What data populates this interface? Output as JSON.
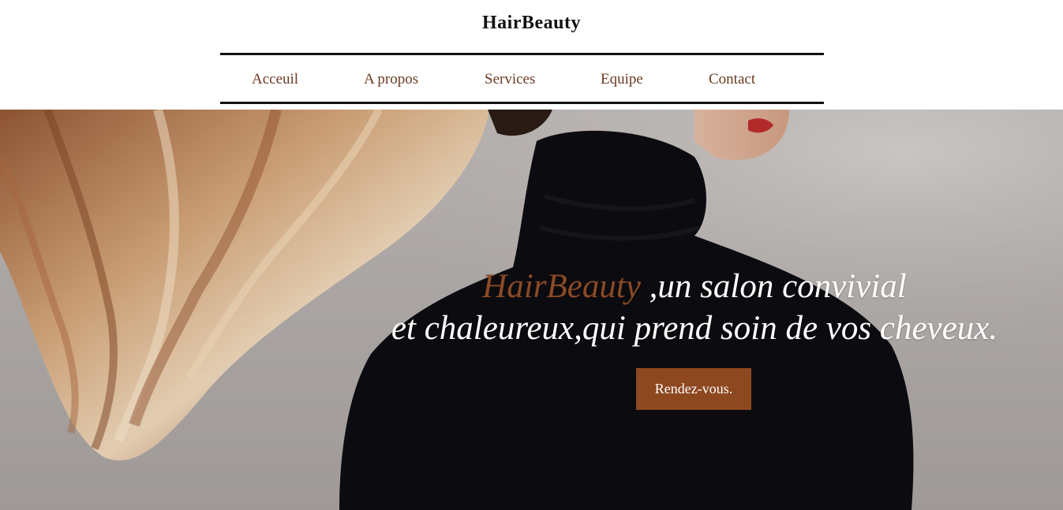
{
  "header": {
    "brand": "HairBeauty",
    "nav": [
      {
        "label": "Acceuil"
      },
      {
        "label": "A propos"
      },
      {
        "label": "Services"
      },
      {
        "label": "Equipe"
      },
      {
        "label": "Contact"
      }
    ]
  },
  "hero": {
    "tagline_accent": "HairBeauty",
    "tagline_rest": " ,un salon convivial",
    "tagline_line2": "et chaleureux,qui prend soin de vos cheveux.",
    "cta_label": "Rendez-vous."
  },
  "colors": {
    "nav_text": "#6b3a22",
    "accent": "#8b4a26",
    "cta_bg": "#8e4820",
    "hero_bg": "#aaa5a3"
  }
}
